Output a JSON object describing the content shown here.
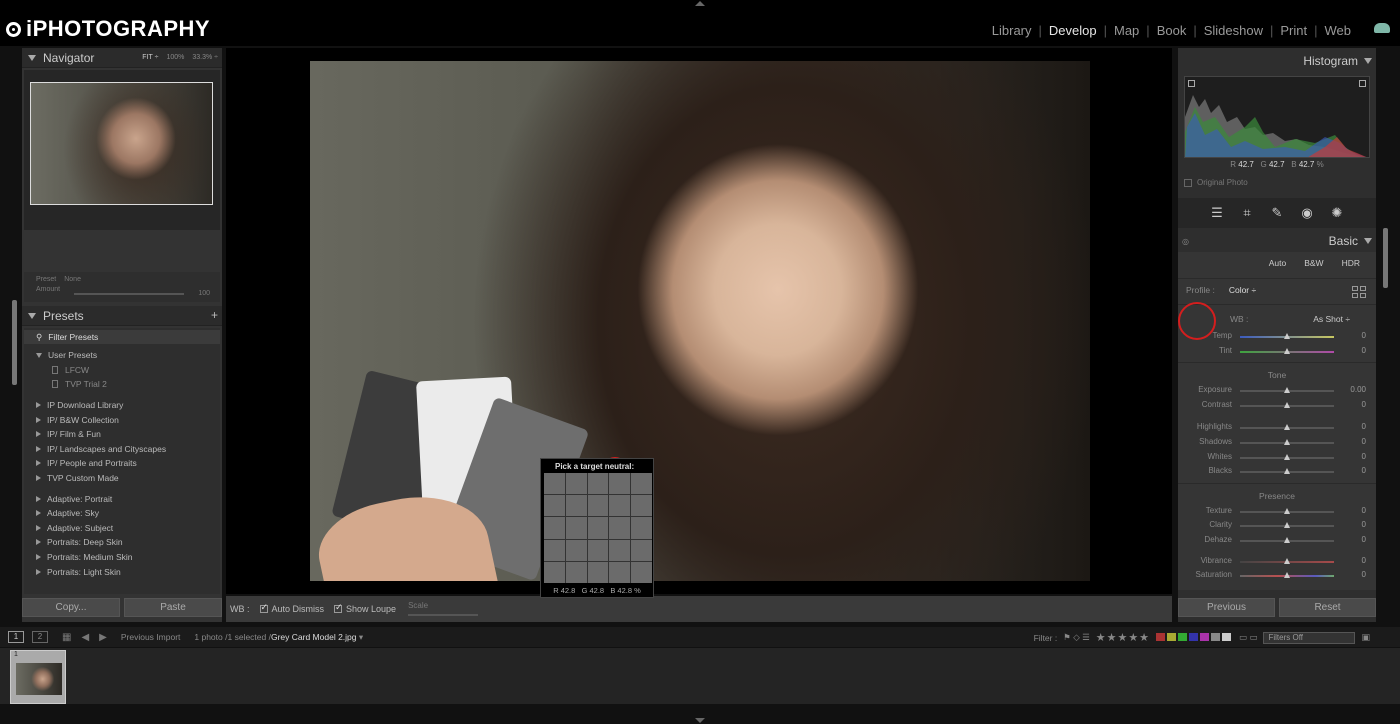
{
  "brand": {
    "logo_text": "iPHOTOGRAPHY"
  },
  "modules": [
    "Library",
    "Develop",
    "Map",
    "Book",
    "Slideshow",
    "Print",
    "Web"
  ],
  "active_module": "Develop",
  "navigator": {
    "title": "Navigator",
    "zoom": [
      "FIT ÷",
      "100%",
      "33.3% ÷"
    ]
  },
  "preset_amount": {
    "preset_label": "Preset",
    "preset_value": "None",
    "amount_label": "Amount",
    "amount_value": "100"
  },
  "presets": {
    "title": "Presets",
    "filter_label": "Filter Presets",
    "user_group": "User Presets",
    "user_items": [
      "LFCW",
      "TVP Trial 2"
    ],
    "groups_a": [
      "IP Download Library",
      "IP/ B&W Collection",
      "IP/ Film & Fun",
      "IP/ Landscapes and Cityscapes",
      "IP/ People and Portraits",
      "TVP Custom Made"
    ],
    "groups_b": [
      "Adaptive: Portrait",
      "Adaptive: Sky",
      "Adaptive: Subject",
      "Portraits: Deep Skin",
      "Portraits: Medium Skin",
      "Portraits: Light Skin"
    ]
  },
  "left_buttons": {
    "copy": "Copy...",
    "paste": "Paste"
  },
  "loupe": {
    "title": "Pick a target neutral:",
    "r": "R 42.8",
    "g": "G 42.8",
    "b": "B 42.8",
    "pct": "%"
  },
  "toolbar": {
    "wb": "WB :",
    "auto_dismiss": "Auto Dismiss",
    "show_loupe": "Show Loupe",
    "scale": "Scale"
  },
  "histogram": {
    "title": "Histogram",
    "r_label": "R",
    "r": "42.7",
    "g_label": "G",
    "g": "42.7",
    "b_label": "B",
    "b": "42.7",
    "pct": "%",
    "original_photo": "Original Photo"
  },
  "basic": {
    "title": "Basic",
    "treatments": [
      "Auto",
      "B&W",
      "HDR"
    ],
    "profile_label": "Profile :",
    "profile_value": "Color ÷",
    "wb_label": "WB :",
    "wb_value": "As Shot ÷",
    "wb_sliders": [
      {
        "label": "Temp",
        "value": "0"
      },
      {
        "label": "Tint",
        "value": "0"
      }
    ],
    "tone_title": "Tone",
    "tone_sliders_a": [
      {
        "label": "Exposure",
        "value": "0.00"
      },
      {
        "label": "Contrast",
        "value": "0"
      }
    ],
    "tone_sliders_b": [
      {
        "label": "Highlights",
        "value": "0"
      },
      {
        "label": "Shadows",
        "value": "0"
      },
      {
        "label": "Whites",
        "value": "0"
      },
      {
        "label": "Blacks",
        "value": "0"
      }
    ],
    "presence_title": "Presence",
    "presence_sliders_a": [
      {
        "label": "Texture",
        "value": "0"
      },
      {
        "label": "Clarity",
        "value": "0"
      },
      {
        "label": "Dehaze",
        "value": "0"
      }
    ],
    "presence_sliders_b": [
      {
        "label": "Vibrance",
        "value": "0"
      },
      {
        "label": "Saturation",
        "value": "0"
      }
    ]
  },
  "right_buttons": {
    "previous": "Previous",
    "reset": "Reset"
  },
  "filmbar": {
    "view1": "1",
    "view2": "2",
    "source": "Previous Import",
    "count": "1 photo",
    "selected": "/1 selected /",
    "filename": "Grey Card Model 2.jpg",
    "filter_label": "Filter :",
    "stars": "★★★★★",
    "filters_off": "Filters Off"
  },
  "filmstrip": {
    "thumb_index": "1"
  },
  "colors": {
    "annotation_red": "#d41e1e",
    "label_swatches": [
      "#a33",
      "#aa3",
      "#3a3",
      "#33a",
      "#a3a",
      "#888",
      "#ccc"
    ]
  }
}
